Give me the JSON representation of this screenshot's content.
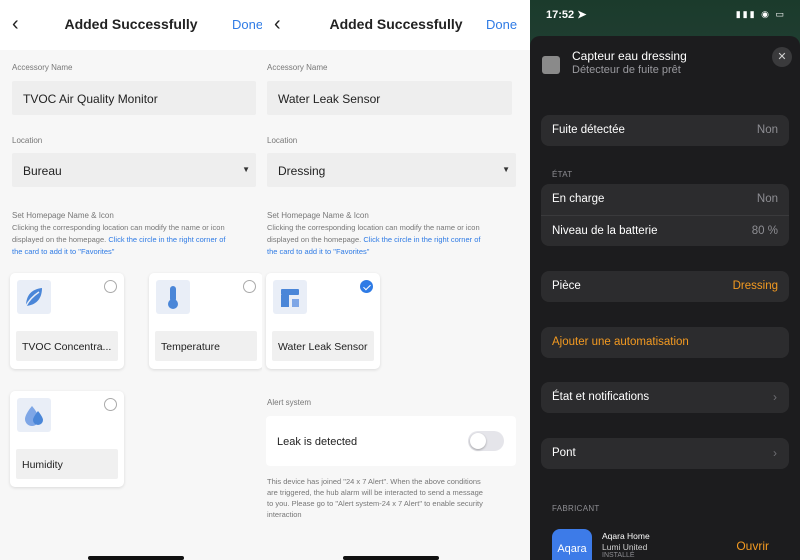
{
  "screen1": {
    "nav": {
      "title": "Added Successfully",
      "done": "Done"
    },
    "accessory_name_label": "Accessory Name",
    "accessory_name": "TVOC Air Quality Monitor",
    "location_label": "Location",
    "location": "Bureau",
    "homepage_label": "Set Homepage Name & Icon",
    "desc1": "Clicking the corresponding location can modify the name or icon",
    "desc2a": "displayed on the homepage. ",
    "desc2b": "Click the circle in the right corner of",
    "desc3": "the card to add it to \"Favorites\"",
    "cards": [
      {
        "name": "TVOC Concentra...",
        "icon": "leaf-icon"
      },
      {
        "name": "Temperature",
        "icon": "thermometer-icon"
      },
      {
        "name": "Humidity",
        "icon": "water-drop-icon"
      }
    ]
  },
  "screen2": {
    "nav": {
      "title": "Added Successfully",
      "done": "Done"
    },
    "accessory_name_label": "Accessory Name",
    "accessory_name": "Water Leak Sensor",
    "location_label": "Location",
    "location": "Dressing",
    "homepage_label": "Set Homepage Name & Icon",
    "desc1": "Clicking the corresponding location can modify the name or icon",
    "desc2a": "displayed on the homepage. ",
    "desc2b": "Click the circle in the right corner of",
    "desc3": "the card to add it to \"Favorites\"",
    "card": {
      "name": "Water Leak Sensor",
      "icon": "water-leak-sensor-icon",
      "selected": true
    },
    "alert_label": "Alert system",
    "alert_row": "Leak is detected",
    "alert_toggle_on": false,
    "note1": "This device has joined \"24 x 7 Alert\".  When the above conditions",
    "note2": "are triggered, the hub alarm will be interacted to send a message",
    "note3": "to you. Please go to \"Alert system-24 x 7 Alert\" to enable security",
    "note4": "interaction"
  },
  "screen3": {
    "status_time": "17:52",
    "header_title": "Capteur eau dressing",
    "header_sub": "Détecteur de fuite prêt",
    "leak_row": {
      "label": "Fuite détectée",
      "value": "Non"
    },
    "state_label": "ÉTAT",
    "state_rows": [
      {
        "label": "En charge",
        "value": "Non"
      },
      {
        "label": "Niveau de la batterie",
        "value": "80 %"
      }
    ],
    "room_row": {
      "label": "Pièce",
      "value": "Dressing"
    },
    "automation": "Ajouter une automatisation",
    "notifications": "État et notifications",
    "bridge": "Pont",
    "manufacturer_label": "FABRICANT",
    "manufacturer": {
      "logo": "Aqara",
      "app": "Aqara Home",
      "company": "Lumi United",
      "installed": "INSTALLÉ",
      "open": "Ouvrir"
    },
    "accent": "#f39a21"
  }
}
